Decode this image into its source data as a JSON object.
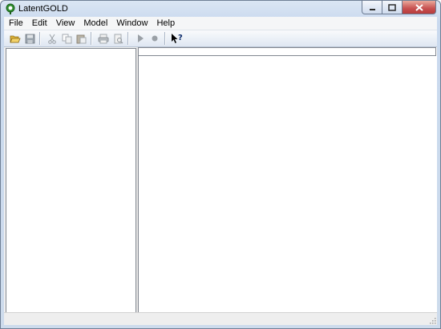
{
  "window": {
    "title": "LatentGOLD"
  },
  "caption_buttons": {
    "minimize_icon": "minimize-icon",
    "maximize_icon": "maximize-icon",
    "close_icon": "close-icon"
  },
  "menu": [
    {
      "label": "File"
    },
    {
      "label": "Edit"
    },
    {
      "label": "View"
    },
    {
      "label": "Model"
    },
    {
      "label": "Window"
    },
    {
      "label": "Help"
    }
  ],
  "toolbar": {
    "buttons": [
      {
        "icon": "open-folder-icon",
        "enabled": true
      },
      {
        "icon": "save-icon",
        "enabled": false
      },
      {
        "icon": "cut-icon",
        "enabled": false
      },
      {
        "icon": "copy-icon",
        "enabled": false
      },
      {
        "icon": "paste-icon",
        "enabled": false
      },
      {
        "icon": "print-icon",
        "enabled": false
      },
      {
        "icon": "print-preview-icon",
        "enabled": false
      },
      {
        "icon": "run-icon",
        "enabled": false
      },
      {
        "icon": "stop-icon",
        "enabled": false
      },
      {
        "icon": "context-help-icon",
        "enabled": true
      }
    ]
  },
  "status": {
    "text": ""
  },
  "colors": {
    "titlebar": "#c9d9ee",
    "menubar": "#f5f6f7",
    "close_button": "#c75050",
    "pane_border": "#828790"
  }
}
